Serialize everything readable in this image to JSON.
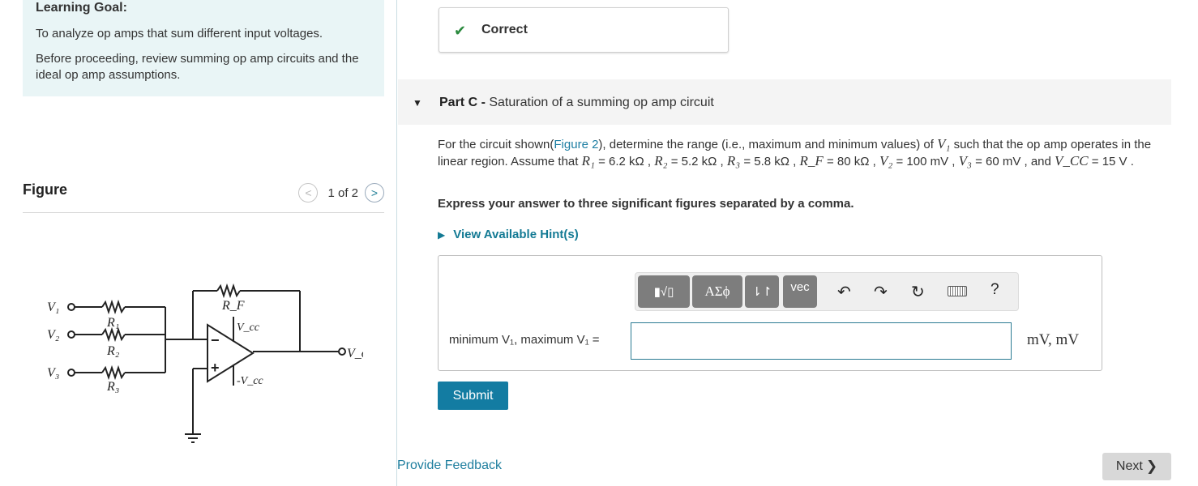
{
  "learning_goal": {
    "title": "Learning Goal:",
    "line1": "To analyze op amps that sum different input voltages.",
    "line2": "Before proceeding, review summing op amp circuits and the ideal op amp assumptions."
  },
  "figure": {
    "label": "Figure",
    "pager": "1 of 2",
    "prev_glyph": "<",
    "next_glyph": ">",
    "circuit_labels": {
      "v1": "V₁",
      "v2": "V₂",
      "v3": "V₃",
      "r1": "R₁",
      "r2": "R₂",
      "r3": "R₃",
      "rf": "R_F",
      "vcc": "V_cc",
      "neg_vcc": "-V_cc",
      "vo": "V_o",
      "minus": "−",
      "plus": "+"
    }
  },
  "status": {
    "text": "Correct"
  },
  "part": {
    "prefix": "Part C -",
    "title": "Saturation of a summing op amp circuit"
  },
  "question": {
    "t1": "For the circuit shown(",
    "link": "Figure 2",
    "t2": "), determine the range (i.e., maximum and minimum values) of",
    "v1": "V₁",
    "t3": "such that the op amp operates in the linear region. Assume that",
    "r1": "R₁",
    "r1_val": "= 6.2 kΩ ,",
    "r2": "R₂",
    "r2_val": "= 5.2 kΩ ,",
    "r3": "R₃",
    "r3_val": "= 5.8 kΩ ,",
    "rf": "R_F",
    "rf_val": "= 80 kΩ ,",
    "v2": "V₂",
    "v2_val": "= 100 mV ,",
    "v3": "V₃",
    "v3_val": "= 60 mV , and",
    "vcc": "V_CC",
    "vcc_val": "= 15 V ."
  },
  "instruction": "Express your answer to three significant figures separated by a comma.",
  "hints_link": "View Available Hint(s)",
  "toolbar": {
    "templates": "▮√▯",
    "greek": "ΑΣϕ",
    "arrows": "⇂↾",
    "vec": "vec",
    "undo_icon": "undo-icon",
    "redo_icon": "redo-icon",
    "reset_icon": "reset-icon",
    "keyboard_icon": "keyboard-icon",
    "help": "?"
  },
  "answer": {
    "label": "minimum V₁, maximum V₁ =",
    "value": "",
    "units": "mV, mV"
  },
  "submit_label": "Submit",
  "feedback_link": "Provide Feedback",
  "next_label": "Next"
}
